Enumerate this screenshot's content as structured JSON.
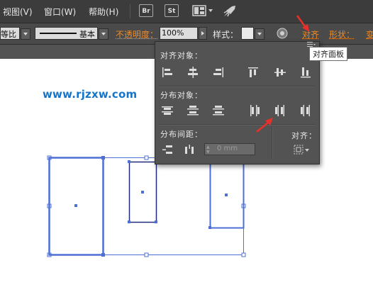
{
  "menu": {
    "view": "视图(V)",
    "window": "窗口(W)",
    "help": "帮助(H)"
  },
  "toolbar_icons": {
    "br": "Br",
    "st": "St"
  },
  "control_bar": {
    "ratio_value": "等比",
    "stroke_profile": "基本",
    "opacity_label": "不透明度：",
    "opacity_value": "100%",
    "style_label": "样式：",
    "align_link": "对齐",
    "shape_link": "形状：",
    "transform_link": "变"
  },
  "watermark": "www.rjzxw.com",
  "align_panel": {
    "align_objects_title": "对齐对象：",
    "distribute_objects_title": "分布对象：",
    "distribute_spacing_title": "分布间距：",
    "align_to_title": "对齐：",
    "spacing_value": "0 mm"
  },
  "tooltip": "对齐面板",
  "colors": {
    "arrow": "#e8302a",
    "selection": "#4d6fd6",
    "accent": "#f08a24"
  }
}
